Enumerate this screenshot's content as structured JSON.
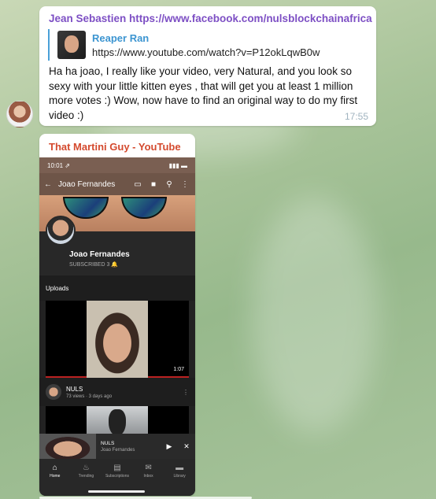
{
  "message1": {
    "forwarded_from": "Jean Sebastien https://www.facebook.com/nulsblockchainafrica",
    "reply": {
      "name": "Reaper Ran",
      "text": "https://www.youtube.com/watch?v=P12okLqwB0w"
    },
    "text": "Ha ha joao, I really like your video, very Natural, and you look so sexy with your little kitten eyes , that will get you at least 1 million more votes :) Wow, now have to find an original way to do my first video :)",
    "time": "17:55"
  },
  "message2": {
    "link_title": "That Martini Guy - YouTube",
    "screenshot": {
      "status_time": "10:01 ⇗",
      "channel_name": "Joao Fernandes",
      "channel_title": "Joao Fernandes",
      "subscribed": "SUBSCRIBED 3",
      "uploads_label": "Uploads",
      "video": {
        "duration": "1:07",
        "title": "NULS",
        "meta": "73 views · 3 days ago"
      },
      "mini_player": {
        "title": "NULS",
        "subtitle": "Joao Fernandes"
      },
      "nav": [
        {
          "label": "Home",
          "icon": "home-icon"
        },
        {
          "label": "Trending",
          "icon": "flame-icon"
        },
        {
          "label": "Subscriptions",
          "icon": "subscriptions-icon"
        },
        {
          "label": "Inbox",
          "icon": "inbox-icon"
        },
        {
          "label": "Library",
          "icon": "folder-icon"
        }
      ]
    }
  },
  "colors": {
    "forward_header": "#7d4fc4",
    "reply_name": "#3c95d1",
    "link_title": "#d44a2e",
    "time": "#a0b3bf"
  }
}
